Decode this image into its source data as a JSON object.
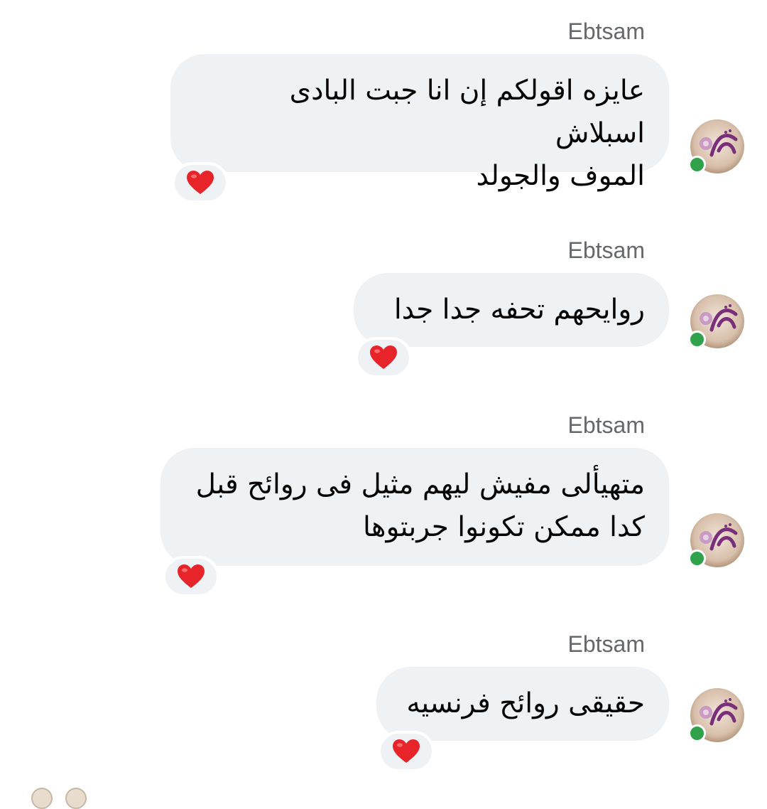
{
  "messages": [
    {
      "sender": "Ebtsam",
      "text": "عايزه اقولكم إن انا جبت البادى اسبلاش\nالموف والجولد",
      "reaction": "heart"
    },
    {
      "sender": "Ebtsam",
      "text": "روايحهم تحفه جدا جدا",
      "reaction": "heart"
    },
    {
      "sender": "Ebtsam",
      "text": "متهيألى مفيش ليهم مثيل فى روائح قبل\nكدا ممكن تكونوا جربتوها",
      "reaction": "heart"
    },
    {
      "sender": "Ebtsam",
      "text": "حقيقى روائح فرنسيه",
      "reaction": "heart"
    }
  ],
  "colors": {
    "bubble": "#eff2f5",
    "sender": "#65676b",
    "online": "#31a24c",
    "heart": "#e8242b"
  }
}
